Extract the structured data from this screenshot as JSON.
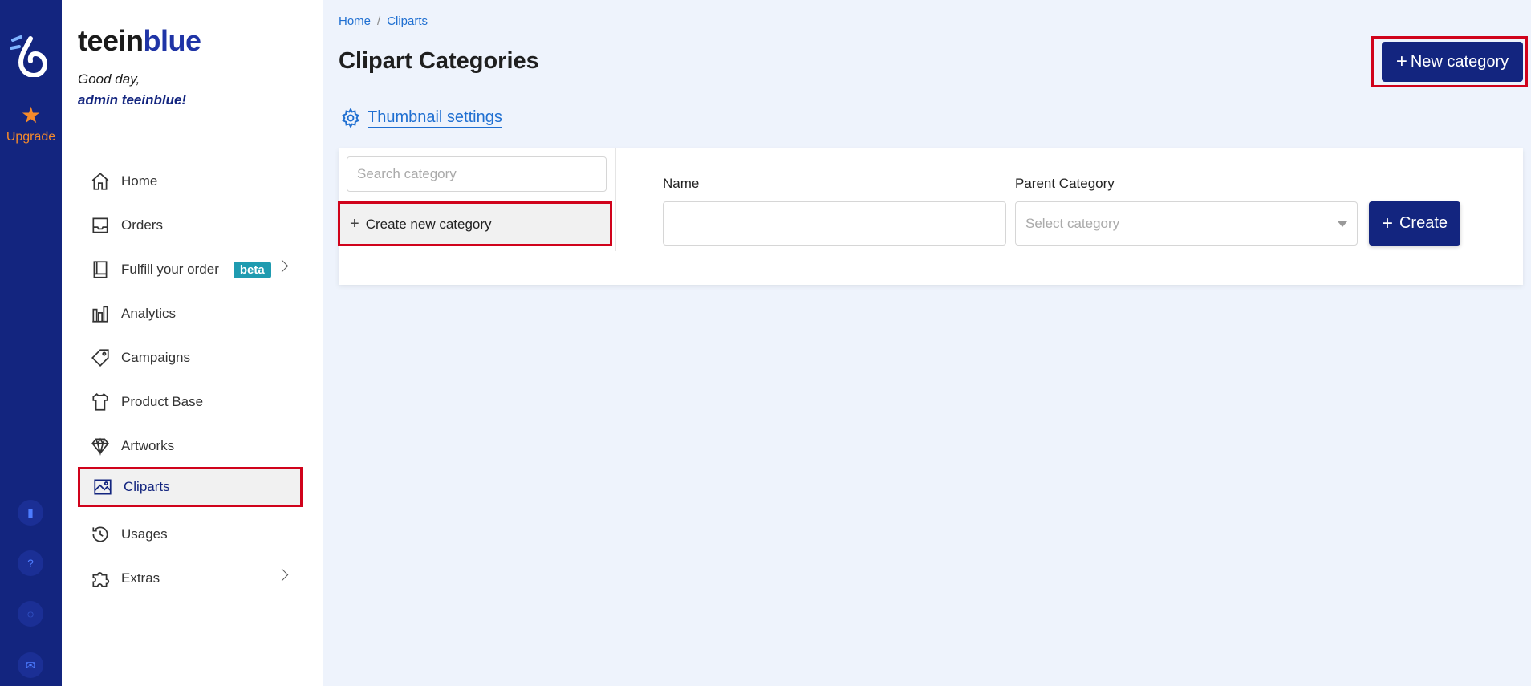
{
  "rail": {
    "upgrade_label": "Upgrade",
    "bottom_icons": [
      "book-icon",
      "question-icon",
      "chat-icon",
      "mail-icon"
    ],
    "accent": "#f58a2b",
    "bg": "#13257f"
  },
  "brand": {
    "part1": "teein",
    "part2": "blue"
  },
  "greeting": {
    "line1": "Good day,",
    "line2": "admin teeinblue!"
  },
  "nav": {
    "home": "Home",
    "orders": "Orders",
    "fulfill": "Fulfill your order",
    "fulfill_badge": "beta",
    "analytics": "Analytics",
    "campaigns": "Campaigns",
    "product_base": "Product Base",
    "artworks": "Artworks",
    "cliparts": "Cliparts",
    "usages": "Usages",
    "extras": "Extras"
  },
  "breadcrumb": {
    "home": "Home",
    "sep": "/",
    "current": "Cliparts"
  },
  "page": {
    "title": "Clipart Categories",
    "new_category": "New category",
    "thumbnail_settings": "Thumbnail settings"
  },
  "panel": {
    "search_placeholder": "Search category",
    "create_new": "Create new category",
    "name_label": "Name",
    "parent_label": "Parent Category",
    "parent_placeholder": "Select category",
    "create_button": "Create"
  }
}
